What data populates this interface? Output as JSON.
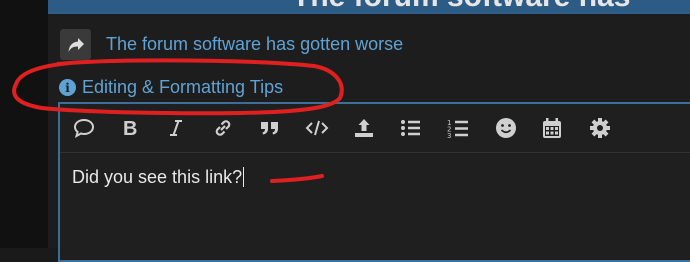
{
  "top": {
    "title": "The forum software has"
  },
  "reply": {
    "title": "The forum software has gotten worse",
    "icon": "share-forward-icon"
  },
  "tips": {
    "label": "Editing & Formatting Tips",
    "icon": "info-circle-icon"
  },
  "editor": {
    "text": "Did you see this link?",
    "toolbar": [
      "speech-bubble-icon",
      "bold-icon",
      "italic-icon",
      "link-icon",
      "quote-icon",
      "code-icon",
      "upload-icon",
      "bullet-list-icon",
      "numbered-list-icon",
      "emoji-icon",
      "calendar-icon",
      "gear-icon"
    ]
  },
  "colors": {
    "accent": "#5fa3d6",
    "annotation": "#e02020",
    "editor_border": "#3b6f9a"
  }
}
